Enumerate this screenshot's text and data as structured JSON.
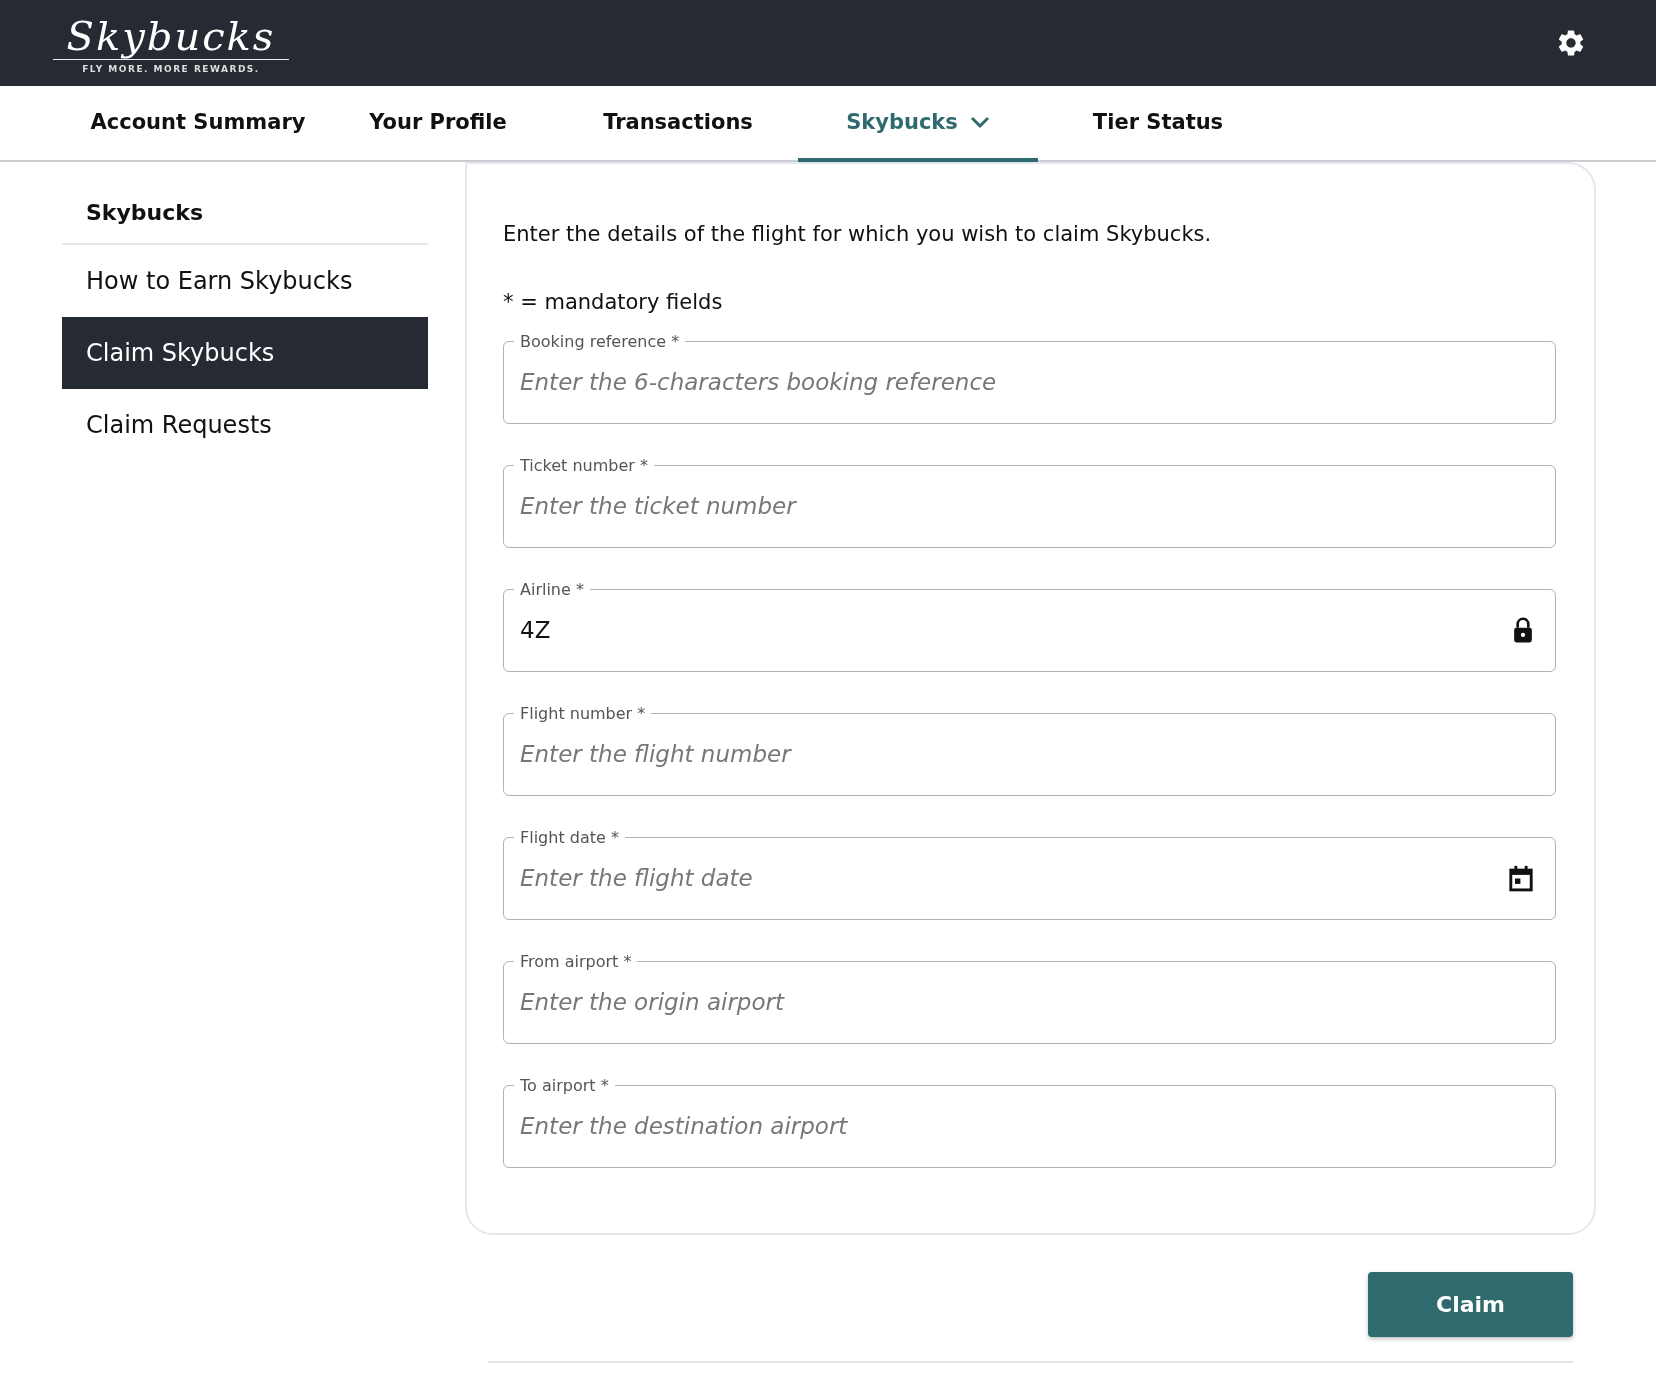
{
  "header": {
    "logo": "Skybucks",
    "tagline": "FLY MORE. MORE REWARDS."
  },
  "tabs": [
    {
      "label": "Account Summary",
      "selected": false,
      "dropdown": false
    },
    {
      "label": "Your Profile",
      "selected": false,
      "dropdown": false
    },
    {
      "label": "Transactions",
      "selected": false,
      "dropdown": false
    },
    {
      "label": "Skybucks",
      "selected": true,
      "dropdown": true
    },
    {
      "label": "Tier Status",
      "selected": false,
      "dropdown": false
    }
  ],
  "sidebar": {
    "heading": "Skybucks",
    "items": [
      {
        "label": "How to Earn Skybucks",
        "selected": false
      },
      {
        "label": "Claim Skybucks",
        "selected": true
      },
      {
        "label": "Claim Requests",
        "selected": false
      }
    ]
  },
  "form": {
    "intro": "Enter the details of the flight for which you wish to claim Skybucks.",
    "mandatory_note": "* = mandatory fields",
    "fields": [
      {
        "kind": "text",
        "label": "Booking reference *",
        "placeholder": "Enter the 6-characters booking reference"
      },
      {
        "kind": "text",
        "label": "Ticket number *",
        "placeholder": "Enter the ticket number"
      },
      {
        "kind": "locked",
        "label": "Airline *",
        "value": "4Z"
      },
      {
        "kind": "text",
        "label": "Flight number *",
        "placeholder": "Enter the flight number"
      },
      {
        "kind": "date",
        "label": "Flight date *",
        "placeholder": "Enter the flight date"
      },
      {
        "kind": "text",
        "label": "From airport *",
        "placeholder": "Enter the origin airport"
      },
      {
        "kind": "text",
        "label": "To airport *",
        "placeholder": "Enter the destination airport"
      }
    ]
  },
  "claim_button": "Claim"
}
